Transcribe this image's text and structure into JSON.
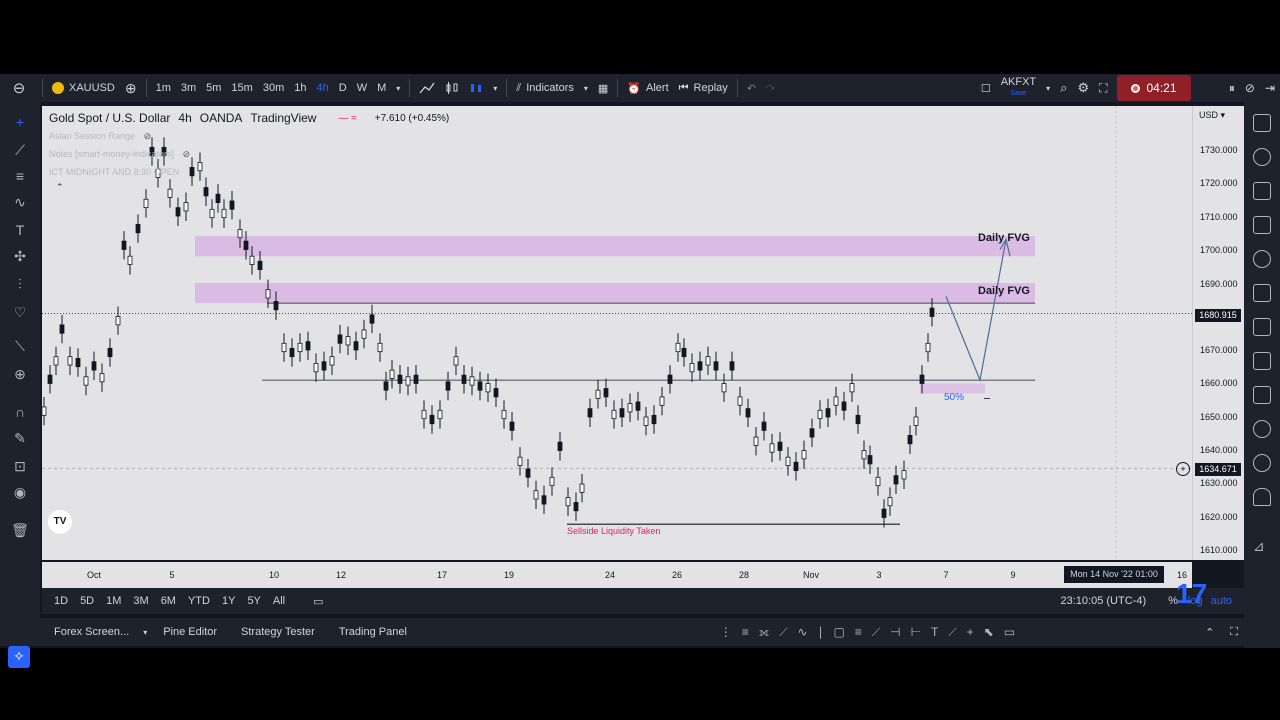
{
  "topbar": {
    "symbol": "XAUUSD",
    "intervals": [
      "1m",
      "3m",
      "5m",
      "15m",
      "30m",
      "1h",
      "4h",
      "D",
      "W",
      "M"
    ],
    "active_interval": "4h",
    "indicators_label": "Indicators",
    "alert_label": "Alert",
    "replay_label": "Replay",
    "layout_name": "AKFXT",
    "layout_sub": "Save",
    "record_time": "04:21"
  },
  "chart": {
    "title": "Gold Spot / U.S. Dollar",
    "interval": "4h",
    "broker": "OANDA",
    "platform": "TradingView",
    "change": "+7.610 (+0.45%)",
    "indicators": [
      "Asian Session Range",
      "Notes [smart-money-indicators]",
      "ICT MIDNIGHT AND 8:30 OPEN"
    ],
    "currency": "USD",
    "annotations": {
      "fvg_upper": "Daily FVG",
      "fvg_lower": "Daily FVG",
      "sellside": "Sellside Liquidity Taken",
      "fifty": "50%"
    },
    "price_labels": {
      "current": "1680.915",
      "cursor": "1634.671"
    },
    "price_ticks": [
      "1730.000",
      "1720.000",
      "1710.000",
      "1700.000",
      "1690.000",
      "1680.000",
      "1670.000",
      "1660.000",
      "1650.000",
      "1640.000",
      "1630.000",
      "1620.000",
      "1610.000"
    ],
    "time_ticks": [
      "Oct",
      "5",
      "10",
      "12",
      "17",
      "19",
      "24",
      "26",
      "28",
      "Nov",
      "3",
      "7",
      "9",
      "16"
    ],
    "cursor_time": "Mon 14 Nov '22  01:00"
  },
  "bottom_bar": {
    "ranges": [
      "1D",
      "5D",
      "1M",
      "3M",
      "6M",
      "YTD",
      "1Y",
      "5Y",
      "All"
    ],
    "clock": "23:10:05 (UTC-4)",
    "percent": "%",
    "log": "log",
    "auto": "auto"
  },
  "panels": {
    "tabs": [
      "Forex Screen...",
      "Pine Editor",
      "Strategy Tester",
      "Trading Panel"
    ]
  },
  "colors": {
    "fvg": "#d8b4e2",
    "candle": "#131722",
    "sellside": "#e91e63",
    "accent": "#2962ff",
    "record": "#8f2027"
  }
}
